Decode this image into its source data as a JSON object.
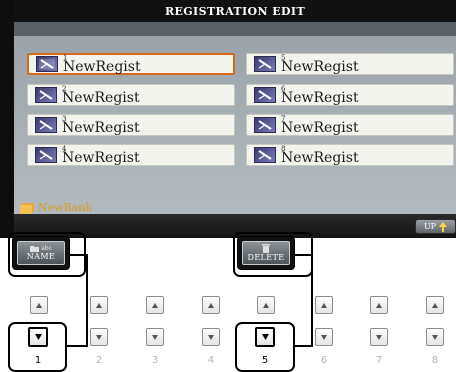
{
  "screen": {
    "title": "REGISTRATION EDIT",
    "registrations": [
      {
        "number": "1",
        "name": "NewRegist",
        "selected": true
      },
      {
        "number": "2",
        "name": "NewRegist",
        "selected": false
      },
      {
        "number": "3",
        "name": "NewRegist",
        "selected": false
      },
      {
        "number": "4",
        "name": "NewRegist",
        "selected": false
      },
      {
        "number": "5",
        "name": "NewRegist",
        "selected": false
      },
      {
        "number": "6",
        "name": "NewRegist",
        "selected": false
      },
      {
        "number": "7",
        "name": "NewRegist",
        "selected": false
      },
      {
        "number": "8",
        "name": "NewRegist",
        "selected": false
      }
    ],
    "bank_name": "NewBank",
    "up_button": "UP"
  },
  "tabs": {
    "name": {
      "label": "NAME",
      "sublabel": "abc"
    },
    "delete": {
      "label": "DELETE"
    }
  },
  "panel_buttons": [
    "1",
    "2",
    "3",
    "4",
    "5",
    "6",
    "7",
    "8"
  ],
  "colors": {
    "screen_bg": "#0d0d0d",
    "selection_border": "#d2691e",
    "bank_text": "#d99a2a"
  },
  "icons": {
    "registration": "registration-memory-icon",
    "bank": "folder-icon",
    "up": "up-arrow-icon",
    "name_tab": "folder-icon",
    "delete_tab": "trash-icon",
    "up_button": "triangle-up-icon",
    "down_button": "triangle-down-icon"
  }
}
